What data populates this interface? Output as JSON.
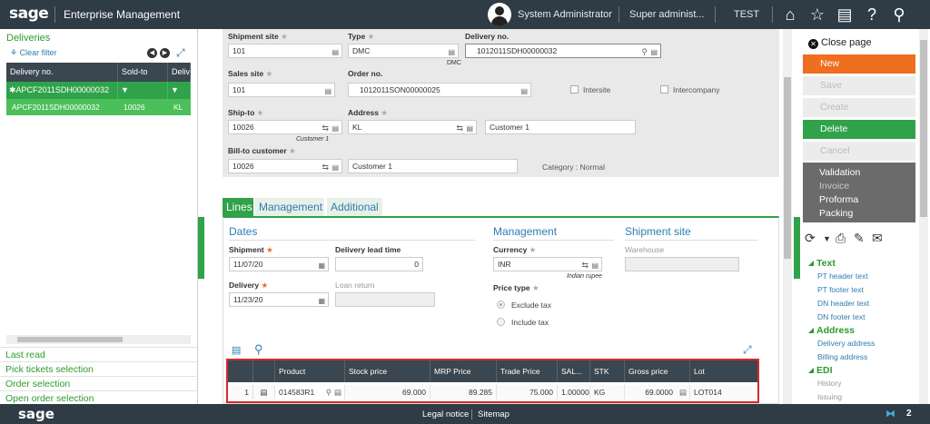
{
  "topbar": {
    "logo": "sage",
    "app_title": "Enterprise Management",
    "user": "System Administrator",
    "role": "Super administ...",
    "folder": "TEST",
    "icons": [
      "home-icon",
      "star-icon",
      "dashboard-icon",
      "help-icon",
      "search-icon"
    ]
  },
  "left_panel": {
    "title": "Deliveries",
    "clear_filter": "Clear filter",
    "columns": [
      "Delivery no.",
      "Sold-to",
      "Deliv"
    ],
    "filter_row": {
      "delivery_no": "APCF2011SDH00000032"
    },
    "rows": [
      {
        "delivery_no": "APCF2011SDH00000032",
        "sold_to": "10026",
        "deliv": "KL"
      }
    ],
    "links": [
      "Last read",
      "Pick tickets selection",
      "Order selection",
      "Open order selection"
    ]
  },
  "header_form": {
    "shipment_site_label": "Shipment site",
    "shipment_site_value": "101",
    "type_label": "Type",
    "type_value": "DMC",
    "type_sub": "DMC",
    "delivery_no_label": "Delivery no.",
    "delivery_no_value": "1012011SDH00000032",
    "sales_site_label": "Sales site",
    "sales_site_value": "101",
    "order_no_label": "Order no.",
    "order_no_value": "1012011SON00000025",
    "intersite_label": "Intersite",
    "intercompany_label": "Intercompany",
    "ship_to_label": "Ship-to",
    "ship_to_value": "10026",
    "ship_to_sub": "Customer 1",
    "address_label": "Address",
    "address_value": "KL",
    "address_name": "Customer 1",
    "bill_to_label": "Bill-to customer",
    "bill_to_value": "10026",
    "bill_to_name": "Customer 1",
    "category": "Category : Normal"
  },
  "tabs": [
    "Lines",
    "Management",
    "Additional"
  ],
  "lines": {
    "dates_head": "Dates",
    "shipment_label": "Shipment",
    "shipment_value": "11/07/20",
    "lead_time_label": "Delivery lead time",
    "lead_time_value": "0",
    "delivery_label": "Delivery",
    "delivery_value": "11/23/20",
    "loan_return_label": "Loan return",
    "management_head": "Management",
    "currency_label": "Currency",
    "currency_value": "INR",
    "currency_sub": "Indian rupee",
    "price_type_label": "Price type",
    "price_options": [
      "Exclude tax",
      "Include tax"
    ],
    "shipment_site_head": "Shipment site",
    "warehouse_label": "Warehouse",
    "table": {
      "columns": [
        "Product",
        "Stock price",
        "MRP Price",
        "Trade Price",
        "SAL...",
        "STK",
        "Gross price",
        "Lot"
      ],
      "rows": [
        {
          "num": "1",
          "product": "014583R1",
          "stock_price": "69.000",
          "mrp_price": "89.285",
          "trade_price": "75.000",
          "sal": "1.00000",
          "stk": "KG",
          "gross_price": "69.0000",
          "lot": "LOT014"
        }
      ]
    }
  },
  "right_panel": {
    "close_page": "Close page",
    "buttons": {
      "new": "New",
      "save": "Save",
      "create": "Create",
      "delete": "Delete",
      "cancel": "Cancel"
    },
    "menu": [
      {
        "label": "Validation",
        "enabled": true
      },
      {
        "label": "Invoice",
        "enabled": false
      },
      {
        "label": "Proforma",
        "enabled": true
      },
      {
        "label": "Packing",
        "enabled": true
      }
    ],
    "sections": {
      "text": {
        "title": "Text",
        "links": [
          "PT header text",
          "PT footer text",
          "DN header text",
          "DN footer text"
        ]
      },
      "address": {
        "title": "Address",
        "links": [
          "Delivery address",
          "Billing address"
        ]
      },
      "edi": {
        "title": "EDI",
        "links": [
          "History",
          "Issuing"
        ]
      }
    }
  },
  "bottombar": {
    "logo": "sage",
    "legal": "Legal notice",
    "sitemap": "Sitemap",
    "count": "2"
  },
  "colors": {
    "green": "#2fa24a",
    "orange": "#ef6e1f",
    "dark": "#2f3b45",
    "link": "#2d7db3",
    "highlight": "#d62a2a"
  }
}
